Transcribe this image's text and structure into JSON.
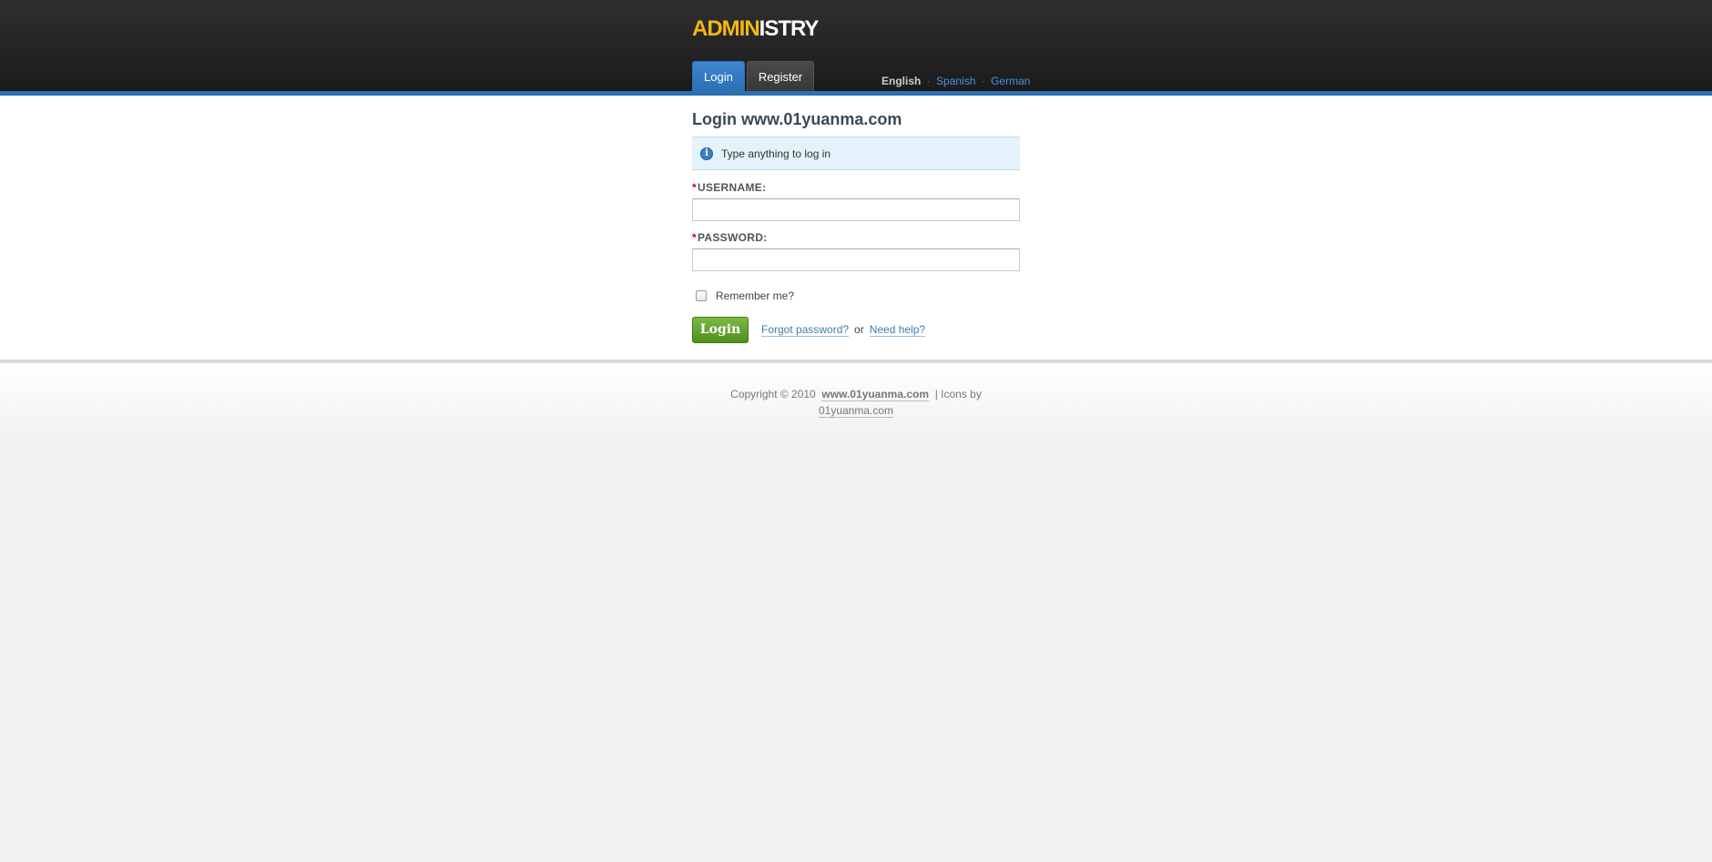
{
  "header": {
    "logo_part1": "ADMIN",
    "logo_part2": "ISTRY",
    "tabs": [
      {
        "label": "Login",
        "active": true
      },
      {
        "label": "Register",
        "active": false
      }
    ],
    "languages": {
      "current": "English",
      "others": [
        "Spanish",
        "German"
      ],
      "separator": "·"
    },
    "accent_color": "#2c6fb3"
  },
  "main": {
    "title": "Login www.01yuanma.com",
    "info_icon": "info-icon",
    "info_text": "Type anything to log in",
    "username_label": "USERNAME:",
    "password_label": "PASSWORD:",
    "required_marker": "*",
    "username_value": "",
    "password_value": "",
    "remember_label": "Remember me?",
    "remember_checked": false,
    "login_button": "Login",
    "forgot_password": "Forgot password?",
    "or_text": "or",
    "need_help": "Need help?"
  },
  "footer": {
    "copyright": "Copyright © 2010",
    "site_link": "www.01yuanma.com",
    "icons_by": "| Icons by",
    "icons_link": "01yuanma.com"
  }
}
